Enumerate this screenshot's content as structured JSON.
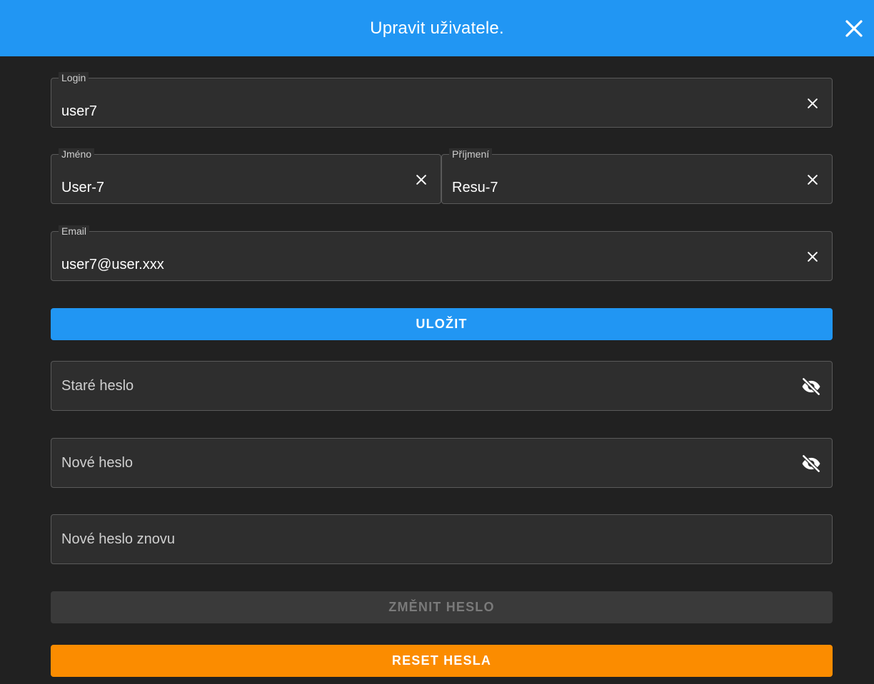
{
  "header": {
    "title": "Upravit uživatele.",
    "background": "#2196f3"
  },
  "fields": {
    "login": {
      "label": "Login",
      "value": "user7"
    },
    "first_name": {
      "label": "Jméno",
      "value": "User-7"
    },
    "last_name": {
      "label": "Příjmení",
      "value": "Resu-7"
    },
    "email": {
      "label": "Email",
      "value": "user7@user.xxx"
    },
    "old_password": {
      "placeholder": "Staré heslo"
    },
    "new_password": {
      "placeholder": "Nové heslo"
    },
    "new_password_again": {
      "placeholder": "Nové heslo znovu"
    }
  },
  "buttons": {
    "save": "ULOŽIT",
    "change_password": "ZMĚNIT HESLO",
    "reset_password": "RESET HESLA"
  },
  "colors": {
    "primary": "#2196f3",
    "warning": "#fb8c00",
    "disabled": "#3a3a3a",
    "background": "#212121"
  },
  "icons": {
    "header_close": "close-icon",
    "clear": "close-icon",
    "password_visibility": "eye-off-icon"
  }
}
